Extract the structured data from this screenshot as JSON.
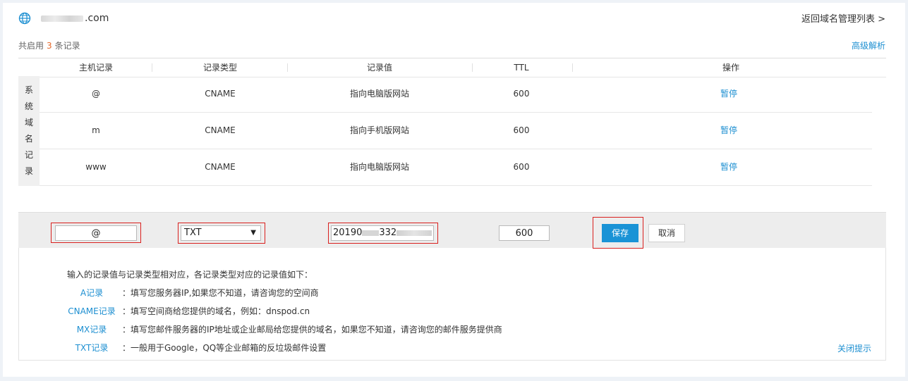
{
  "header": {
    "domain_suffix": ".com",
    "back_link": "返回域名管理列表 >",
    "summary_prefix": "共启用",
    "summary_count": "3",
    "summary_suffix": "条记录",
    "advanced_link": "高级解析"
  },
  "table": {
    "columns": [
      "主机记录",
      "记录类型",
      "记录值",
      "TTL",
      "操作"
    ],
    "group_label": [
      "系",
      "统",
      "域",
      "名",
      "记",
      "录"
    ],
    "rows": [
      {
        "host": "@",
        "type": "CNAME",
        "value": "指向电脑版网站",
        "ttl": "600",
        "action": "暂停"
      },
      {
        "host": "m",
        "type": "CNAME",
        "value": "指向手机版网站",
        "ttl": "600",
        "action": "暂停"
      },
      {
        "host": "www",
        "type": "CNAME",
        "value": "指向电脑版网站",
        "ttl": "600",
        "action": "暂停"
      }
    ]
  },
  "edit": {
    "host_value": "@",
    "type_selected": "TXT",
    "value_prefix": "20190",
    "value_mid": "332",
    "ttl_value": "600",
    "save_label": "保存",
    "cancel_label": "取消"
  },
  "hints": {
    "intro": "输入的记录值与记录类型相对应，各记录类型对应的记录值如下：",
    "items": [
      {
        "type": "A记录",
        "desc": "：填写您服务器IP,如果您不知道，请咨询您的空间商"
      },
      {
        "type": "CNAME记录",
        "desc": "：填写空间商给您提供的域名，例如：dnspod.cn"
      },
      {
        "type": "MX记录",
        "desc": "：填写您邮件服务器的IP地址或企业邮局给您提供的域名，如果您不知道，请咨询您的邮件服务提供商"
      },
      {
        "type": "TXT记录",
        "desc": "：一般用于Google，QQ等企业邮箱的反垃圾邮件设置"
      }
    ],
    "close_label": "关闭提示"
  },
  "colors": {
    "accent": "#1d8fd1",
    "save_button": "#1a93d6",
    "highlight_box": "#d9201e",
    "count": "#e5682a"
  }
}
